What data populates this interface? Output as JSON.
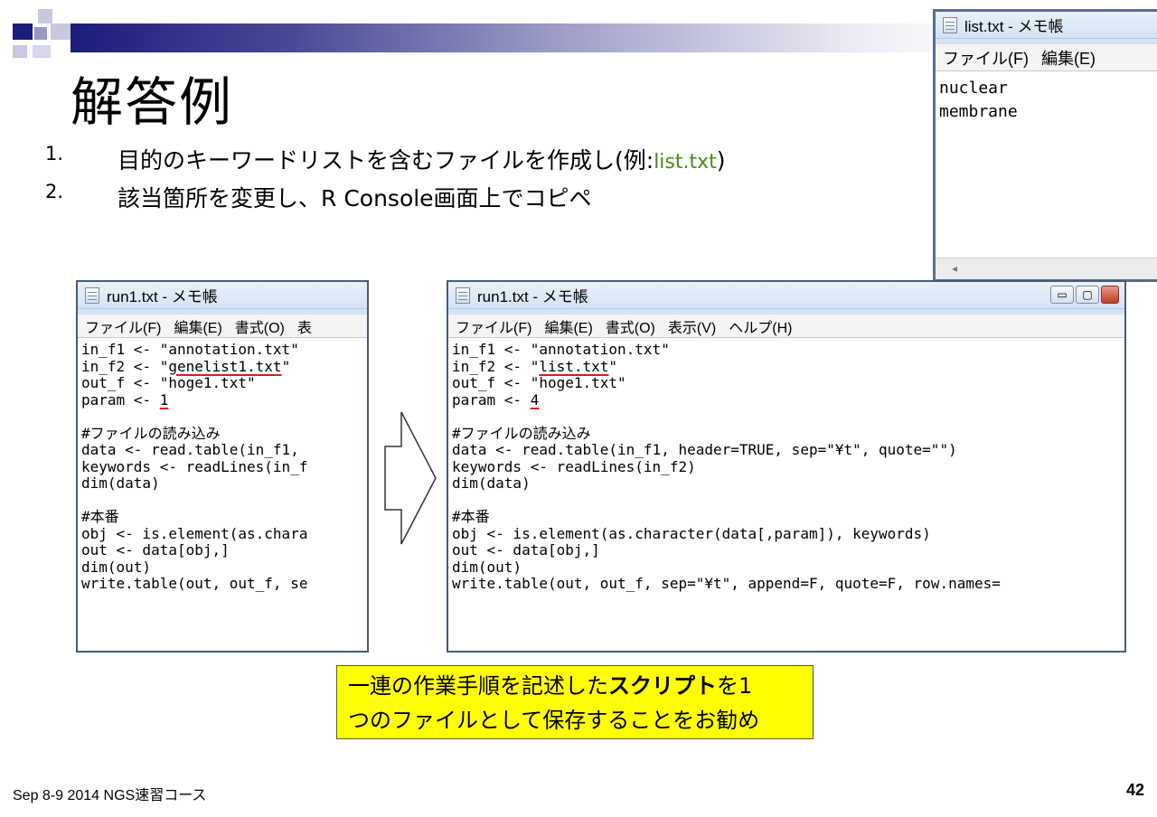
{
  "slide": {
    "title": "解答例",
    "bullets": [
      {
        "num": "1.",
        "text": "目的のキーワードリストを含むファイルを作成し(例:",
        "highlight": "list.txt",
        "after": ")"
      },
      {
        "num": "2.",
        "text": "該当箇所を変更し、R Console画面上でコピペ"
      }
    ],
    "note_line1_pre": "一連の作業手順を記述した",
    "note_line1_bold": "スクリプト",
    "note_line1_post": "を1",
    "note_line2": "つのファイルとして保存することをお勧め",
    "footer": "Sep 8-9 2014 NGS速習コース",
    "page_number": "42"
  },
  "list_window": {
    "title": "list.txt - メモ帳",
    "menu": [
      "ファイル(F)",
      "編集(E)"
    ],
    "lines": [
      "nuclear",
      "membrane"
    ],
    "scroll_left": "◂"
  },
  "left_window": {
    "title": "run1.txt - メモ帳",
    "menu": [
      "ファイル(F)",
      "編集(E)",
      "書式(O)",
      "表"
    ],
    "l1": "in_f1 <- \"annotation.txt\"",
    "l2_pre": "in_f2 <- \"",
    "l2_ul": "genelist1.txt",
    "l2_post": "\"",
    "l3": "out_f <- \"hoge1.txt\"",
    "l4_pre": "param <- ",
    "l4_ul": "1",
    "l5": "",
    "l6": "#ファイルの読み込み",
    "l7": "data <- read.table(in_f1,",
    "l8": "keywords <- readLines(in_f",
    "l9": "dim(data)",
    "l10": "",
    "l11": "#本番",
    "l12": "obj <- is.element(as.chara",
    "l13": "out <- data[obj,]",
    "l14": "dim(out)",
    "l15": "write.table(out, out_f, se"
  },
  "right_window": {
    "title": "run1.txt - メモ帳",
    "menu": [
      "ファイル(F)",
      "編集(E)",
      "書式(O)",
      "表示(V)",
      "ヘルプ(H)"
    ],
    "buttons": {
      "minimize": "▭",
      "maximize": "▢"
    },
    "l1": "in_f1 <- \"annotation.txt\"",
    "l2_pre": "in_f2 <- \"",
    "l2_ul": "list.txt",
    "l2_post": "\"",
    "l3": "out_f <- \"hoge1.txt\"",
    "l4_pre": "param <- ",
    "l4_ul": "4",
    "l5": "",
    "l6": "#ファイルの読み込み",
    "l7": "data <- read.table(in_f1, header=TRUE, sep=\"¥t\", quote=\"\")",
    "l8": "keywords <- readLines(in_f2)",
    "l9": "dim(data)",
    "l10": "",
    "l11": "#本番",
    "l12": "obj <- is.element(as.character(data[,param]), keywords)",
    "l13": "out <- data[obj,]",
    "l14": "dim(out)",
    "l15": "write.table(out, out_f, sep=\"¥t\", append=F, quote=F, row.names="
  },
  "colors": {
    "header_bar_start": "#1c1c7a",
    "highlight_green": "#4a8c1c",
    "note_bg": "#ffff00",
    "underline_red": "#e01818"
  }
}
